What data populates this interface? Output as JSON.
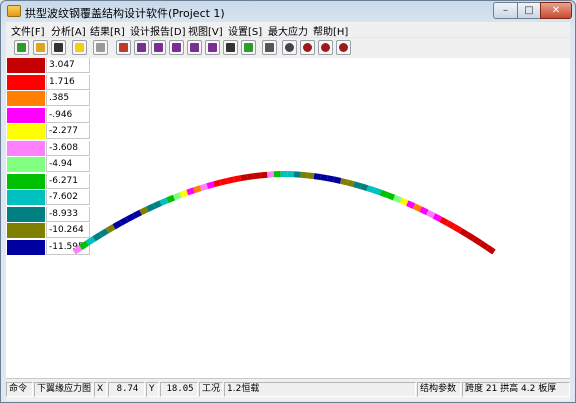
{
  "window": {
    "title": "拱型波纹钢覆盖结构设计软件(Project 1)"
  },
  "menu": [
    {
      "label": "文件[F]"
    },
    {
      "label": "分析[A]"
    },
    {
      "label": "结果[R]"
    },
    {
      "label": "设计报告[D]"
    },
    {
      "label": "视图[V]"
    },
    {
      "label": "设置[S]"
    },
    {
      "label": "最大应力"
    },
    {
      "label": "帮助[H]"
    }
  ],
  "toolbar": [
    {
      "name": "new-project-icon",
      "color": "#2e9b2e"
    },
    {
      "name": "open-folder-icon",
      "color": "#e0a520"
    },
    {
      "name": "save-icon",
      "color": "#333333"
    },
    {
      "name": "layers-icon",
      "color": "#f2d100"
    },
    {
      "name": "calculator-icon",
      "color": "#9a9a9a"
    },
    {
      "name": "section-tool-icon",
      "color": "#c0392b"
    },
    {
      "name": "line-tool-1-icon",
      "color": "#7a2e8f"
    },
    {
      "name": "line-tool-2-icon",
      "color": "#7a2e8f"
    },
    {
      "name": "line-tool-3-icon",
      "color": "#7a2e8f"
    },
    {
      "name": "bracket-tool-1-icon",
      "color": "#7a2e8f"
    },
    {
      "name": "bracket-tool-2-icon",
      "color": "#7a2e8f"
    },
    {
      "name": "stack-tool-icon",
      "color": "#333333"
    },
    {
      "name": "chart-tool-icon",
      "color": "#2e9b2e"
    },
    {
      "name": "properties-icon",
      "color": "#555555"
    },
    {
      "name": "pan-hand-icon",
      "color": "#444444"
    },
    {
      "name": "zoom-in-icon",
      "color": "#9b1b1b"
    },
    {
      "name": "zoom-out-icon",
      "color": "#9b1b1b"
    },
    {
      "name": "zoom-fit-icon",
      "color": "#9b1b1b"
    }
  ],
  "legend": [
    {
      "value": "3.047",
      "color": "#c40000"
    },
    {
      "value": "1.716",
      "color": "#ff0000"
    },
    {
      "value": ".385",
      "color": "#ff7f00"
    },
    {
      "value": "-.946",
      "color": "#ff00ff"
    },
    {
      "value": "-2.277",
      "color": "#ffff00"
    },
    {
      "value": "-3.608",
      "color": "#ff80ff"
    },
    {
      "value": "-4.94",
      "color": "#80ff80"
    },
    {
      "value": "-6.271",
      "color": "#00c000"
    },
    {
      "value": "-7.602",
      "color": "#00c0c0"
    },
    {
      "value": "-8.933",
      "color": "#008080"
    },
    {
      "value": "-10.264",
      "color": "#808000"
    },
    {
      "value": "-11.595",
      "color": "#0000a0"
    }
  ],
  "arch": {
    "segments_left": [
      5,
      7,
      8,
      9,
      9,
      10,
      11,
      11,
      11,
      11,
      10,
      9,
      9,
      8,
      7,
      6,
      4,
      3,
      2,
      5,
      3,
      1,
      1,
      1,
      1,
      0,
      0,
      0,
      0
    ],
    "segments_right": [
      0,
      0,
      0,
      0,
      0,
      1,
      1,
      1,
      3,
      5,
      3,
      2,
      3,
      4,
      6,
      7,
      7,
      8,
      8,
      9,
      9,
      10,
      10,
      11,
      11,
      11,
      11,
      10,
      10,
      9,
      8,
      8,
      7,
      5
    ]
  },
  "status": {
    "command": "命令",
    "view_mode": "下翼缘应力图",
    "x_label": "X",
    "x_value": "8.74",
    "y_label": "Y",
    "y_value": "18.05",
    "case_label": "工况",
    "case_value": "1.2恒载",
    "params_label": "结构参数",
    "params_value": "跨度 21 拱高 4.2 板厚"
  }
}
